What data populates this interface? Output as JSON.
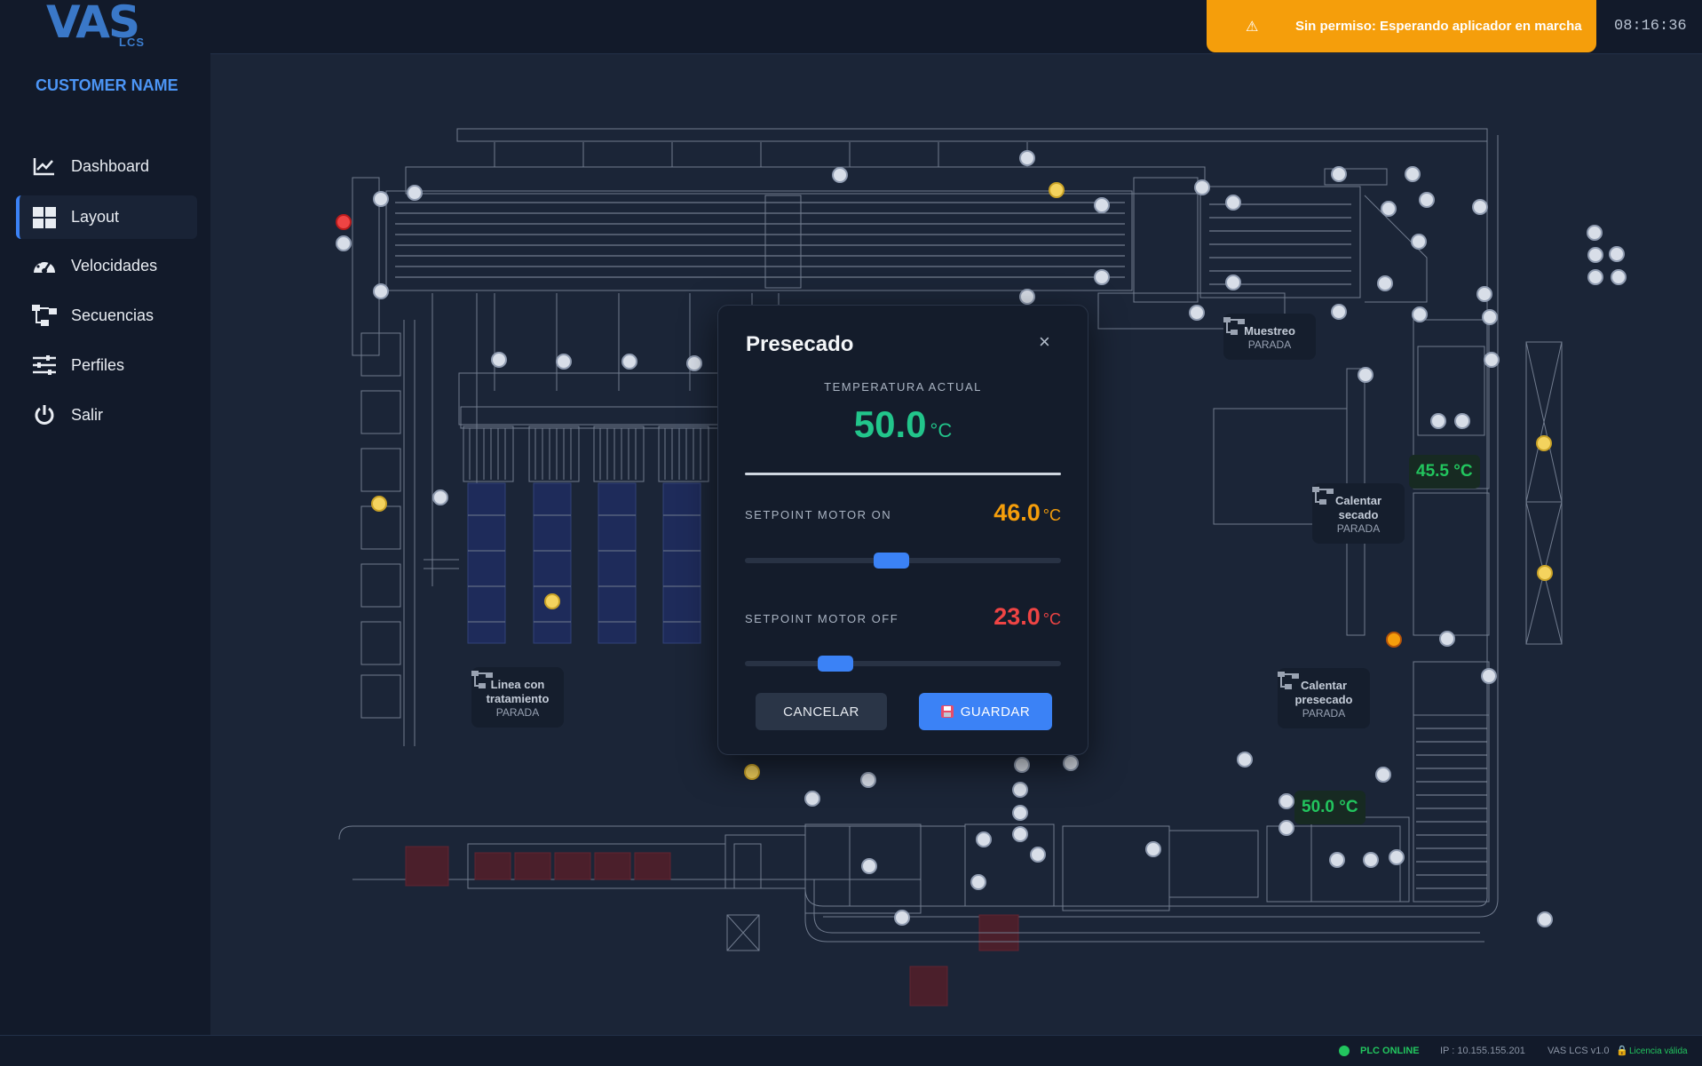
{
  "header": {
    "logo_text": "VAS",
    "logo_sub": "LCS",
    "banner_icon": "⚠",
    "banner_text": "Sin permiso: Esperando aplicador en marcha",
    "clock": "08:16:36"
  },
  "sidebar": {
    "customer": "CUSTOMER NAME",
    "items": [
      {
        "label": "Dashboard",
        "icon": "chart-line-icon"
      },
      {
        "label": "Layout",
        "icon": "grid-icon"
      },
      {
        "label": "Velocidades",
        "icon": "gauge-icon"
      },
      {
        "label": "Secuencias",
        "icon": "sequence-icon"
      },
      {
        "label": "Perfiles",
        "icon": "sliders-icon"
      },
      {
        "label": "Salir",
        "icon": "power-icon"
      }
    ]
  },
  "stations": {
    "muestreo": {
      "title": "Muestreo",
      "state": "PARADA"
    },
    "calentar_secado": {
      "title": "Calentar secado",
      "state": "PARADA"
    },
    "linea_tratamiento": {
      "title": "Linea con tratamiento",
      "state": "PARADA"
    },
    "calentar_presecado": {
      "title": "Calentar presecado",
      "state": "PARADA"
    }
  },
  "temps": {
    "secado": "45.5 °C",
    "presecado": "50.0 °C"
  },
  "modal": {
    "title": "Presecado",
    "close": "×",
    "current_label": "TEMPERATURA ACTUAL",
    "current_value": "50.0",
    "unit": "°C",
    "sp_on_label": "SETPOINT MOTOR ON",
    "sp_on_value": "46.0",
    "sp_on_level": 0.46,
    "sp_off_label": "SETPOINT MOTOR OFF",
    "sp_off_value": "23.0",
    "sp_off_level": 0.26,
    "cancel_label": "CANCELAR",
    "save_label": "GUARDAR"
  },
  "colors": {
    "accent": "#3b82f6",
    "warning": "#f59e0b",
    "ok": "#22c55e",
    "sp_on": "#f59e0b",
    "sp_off": "#ef4444"
  },
  "footer": {
    "plc": "PLC ONLINE",
    "ip": "IP : 10.155.155.201",
    "version": "VAS LCS v1.0",
    "license": "Licencia válida"
  }
}
